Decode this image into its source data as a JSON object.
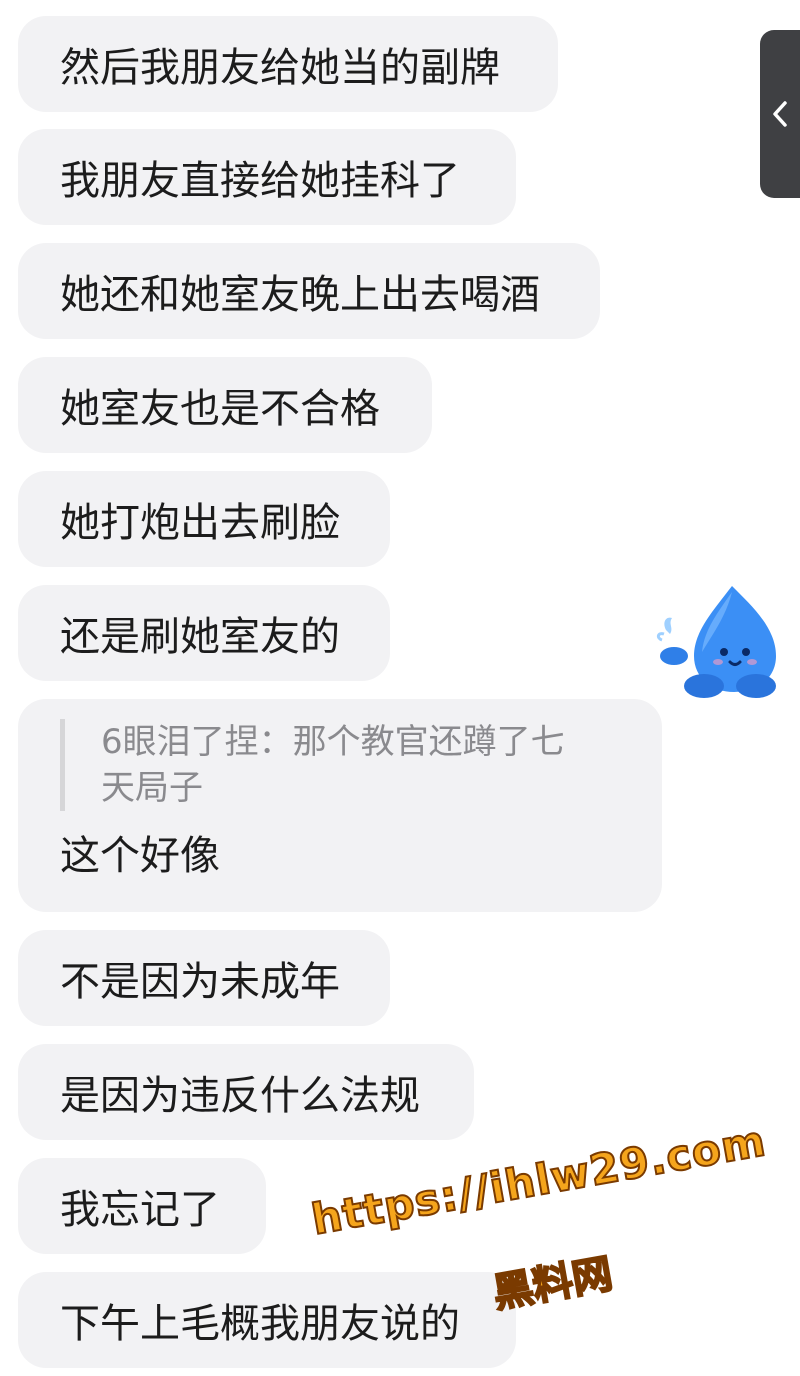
{
  "messages": [
    {
      "text": "然后我朋友给她当的副牌"
    },
    {
      "text": "我朋友直接给她挂科了"
    },
    {
      "text": "她还和她室友晚上出去喝酒"
    },
    {
      "text": "她室友也是不合格"
    },
    {
      "text": "她打炮出去刷脸"
    },
    {
      "text": "还是刷她室友的"
    },
    {
      "quote": "6眼泪了捏：那个教官还蹲了七天局子",
      "text": "这个好像"
    },
    {
      "text": "不是因为未成年"
    },
    {
      "text": "是因为违反什么法规"
    },
    {
      "text": "我忘记了"
    },
    {
      "text": "下午上毛概我朋友说的"
    }
  ],
  "side_tab": {
    "icon": "chevron-left-icon"
  },
  "mascot": {
    "icon": "water-drop-mascot-icon",
    "color": "#3b8ff5"
  },
  "watermark": {
    "url": "https://ihlw29.com",
    "label": "黑料网",
    "color": "#f5a51c"
  },
  "colors": {
    "bubble": "#f2f2f4",
    "text": "#1c1c1c",
    "quote_text": "#8a8a8e"
  }
}
